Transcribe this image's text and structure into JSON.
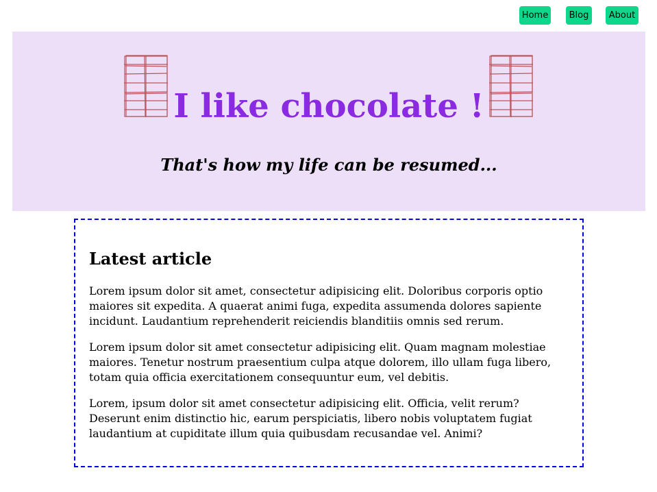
{
  "nav": {
    "items": [
      {
        "label": "Home"
      },
      {
        "label": "Blog"
      },
      {
        "label": "About"
      }
    ]
  },
  "header": {
    "title": "I like chocolate !",
    "tagline": "That's how my life can be resumed...",
    "icon": "chocolate-bar-icon",
    "background": "#eedff9",
    "title_color": "#8a2be2"
  },
  "article": {
    "title": "Latest article",
    "paragraphs": [
      "Lorem ipsum dolor sit amet, consectetur adipisicing elit. Doloribus corporis optio maiores sit expedita. A quaerat animi fuga, expedita assumenda dolores sapiente incidunt. Laudantium reprehenderit reiciendis blanditiis omnis sed rerum.",
      "Lorem ipsum dolor sit amet consectetur adipisicing elit. Quam magnam molestiae maiores. Tenetur nostrum praesentium culpa atque dolorem, illo ullam fuga libero, totam quia officia exercitationem consequuntur eum, vel debitis.",
      "Lorem, ipsum dolor sit amet consectetur adipisicing elit. Officia, velit rerum? Deserunt enim distinctio hic, earum perspiciatis, libero nobis voluptatem fugiat laudantium at cupiditate illum quia quibusdam recusandae vel. Animi?"
    ],
    "border_color": "#0000e6"
  },
  "colors": {
    "nav_button": "#0ed78b",
    "chocolate_outline": "#b5454d"
  }
}
